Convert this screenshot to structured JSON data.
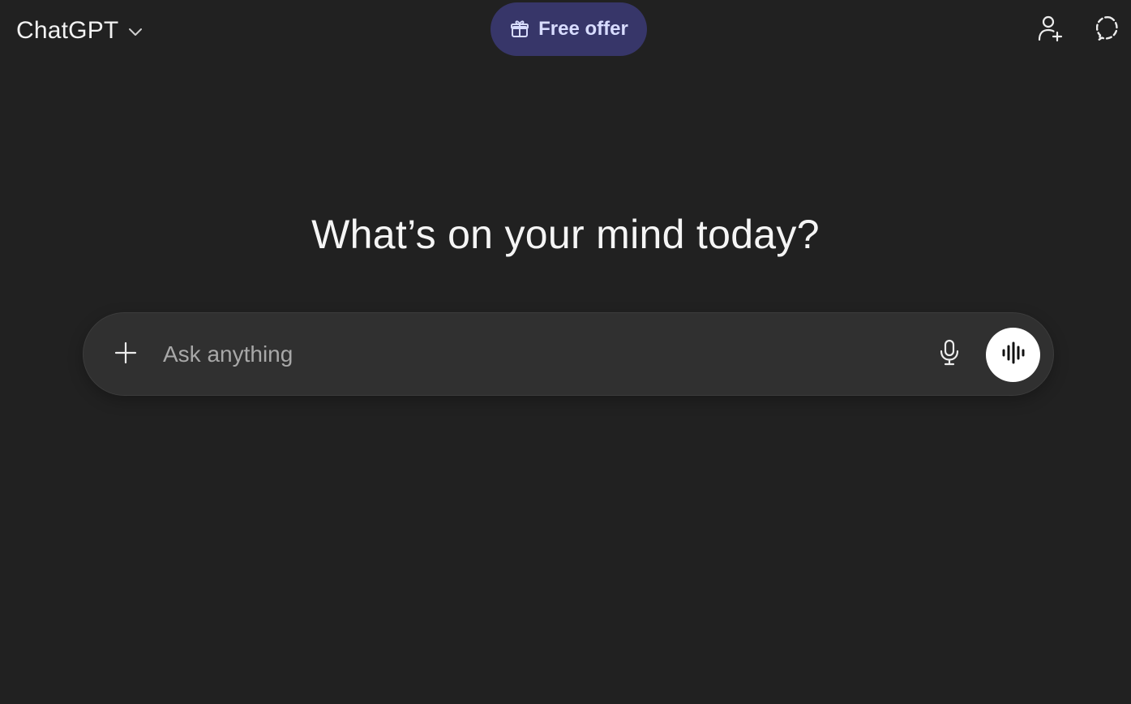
{
  "header": {
    "app_title": "ChatGPT",
    "offer_label": "Free offer",
    "icons": {
      "switcher": "chevron-down-icon",
      "offer": "gift-icon",
      "add_user": "add-user-icon",
      "temporary_chat": "temporary-chat-icon"
    }
  },
  "main": {
    "headline": "What’s on your mind today?"
  },
  "composer": {
    "placeholder": "Ask anything",
    "icons": {
      "attach": "plus-icon",
      "dictate": "microphone-icon",
      "voice_mode": "voice-waveform-icon"
    }
  },
  "colors": {
    "background": "#212121",
    "composer_bg": "#303030",
    "offer_bg": "#373669",
    "offer_text": "#d8dcff",
    "voice_button_bg": "#ffffff"
  }
}
